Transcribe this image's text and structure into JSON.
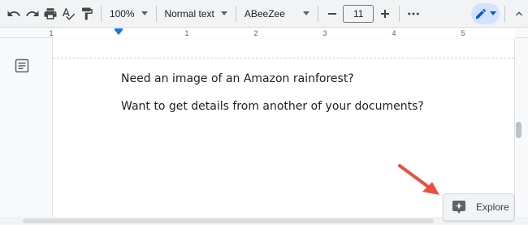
{
  "toolbar": {
    "zoom": "100%",
    "style": "Normal text",
    "font": "ABeeZee",
    "font_size": "11"
  },
  "ruler": {
    "numbers": [
      "1",
      "1",
      "2",
      "3",
      "4",
      "5"
    ]
  },
  "document": {
    "line1": "Need an image of an Amazon rainforest?",
    "line2": "Want to get details from another of your documents?"
  },
  "explore": {
    "label": "Explore"
  },
  "colors": {
    "accent": "#1a73e8",
    "annotation_arrow": "#ea4f3e"
  }
}
